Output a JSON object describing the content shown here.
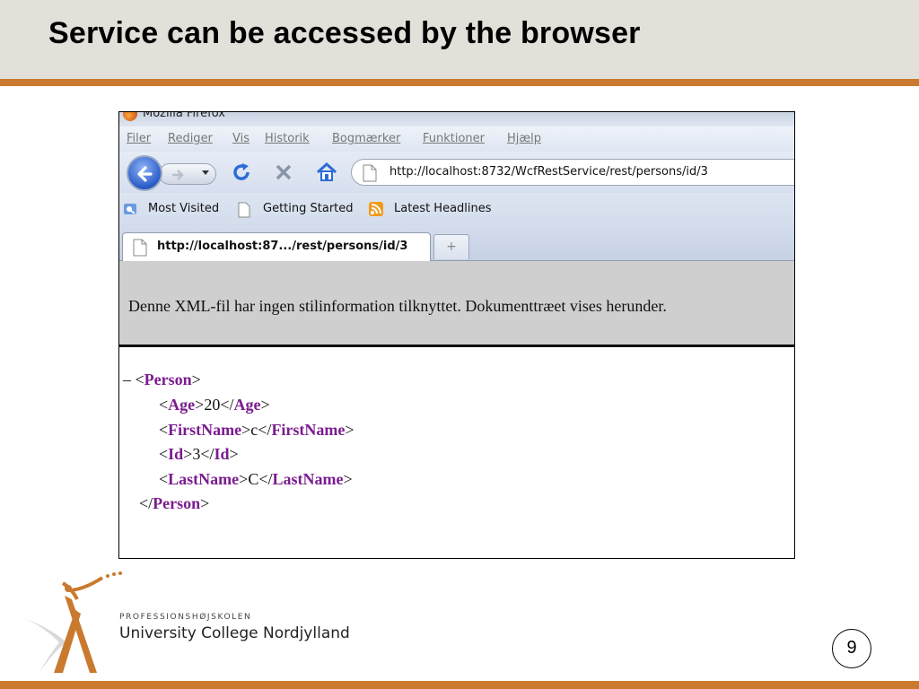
{
  "slide": {
    "title": "Service can be accessed by the browser",
    "page_number": "9",
    "accent_color": "#c97a2e"
  },
  "browser": {
    "window_title": "Mozilla Firefox",
    "menu": [
      "Filer",
      "Rediger",
      "Vis",
      "Historik",
      "Bogmærker",
      "Funktioner",
      "Hjælp"
    ],
    "url": "http://localhost:8732/WcfRestService/rest/persons/id/3",
    "bookmarks": [
      {
        "label": "Most Visited",
        "icon": "bookmark-folder-icon"
      },
      {
        "label": "Getting Started",
        "icon": "page-icon"
      },
      {
        "label": "Latest Headlines",
        "icon": "rss-icon"
      }
    ],
    "tab_label": "http://localhost:87.../rest/persons/id/3",
    "new_tab_label": "+",
    "nav_icons": [
      "back-arrow-icon",
      "forward-arrow-icon",
      "reload-icon",
      "stop-icon",
      "home-icon"
    ]
  },
  "xml_viewer": {
    "info_message": "Denne XML-fil har ingen stilinformation tilknyttet. Dokumenttræet vises herunder.",
    "collapse_marker": "–",
    "root_tag": "Person",
    "children": [
      {
        "tag": "Age",
        "value": "20"
      },
      {
        "tag": "FirstName",
        "value": "c"
      },
      {
        "tag": "Id",
        "value": "3"
      },
      {
        "tag": "LastName",
        "value": "C"
      }
    ]
  },
  "logo": {
    "subtitle": "PROFESSIONSHØJSKOLEN",
    "name": "University College Nordjylland"
  }
}
